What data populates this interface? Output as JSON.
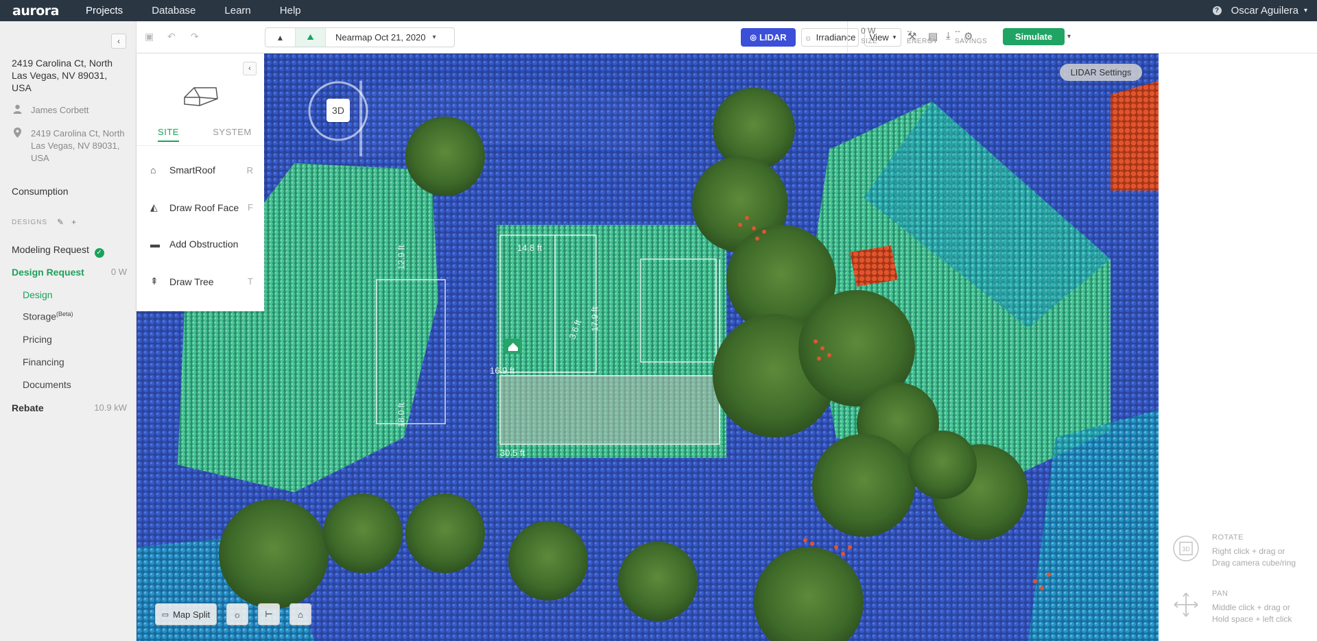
{
  "nav": {
    "logo": "aurora",
    "items": [
      "Projects",
      "Database",
      "Learn",
      "Help"
    ],
    "help_icon": "?",
    "user": "Oscar Aguilera",
    "user_chevron": "⌄"
  },
  "sidebar": {
    "project_title": "2419 Carolina Ct, North Las Vegas, NV 89031, USA",
    "customer": "James Corbett",
    "address": "2419 Carolina Ct, North Las Vegas, NV 89031, USA",
    "consumption": "Consumption",
    "designs_label": "DESIGNS",
    "modeling_request": "Modeling Request",
    "design_request": "Design Request",
    "design_request_value": "0 W",
    "sub_links": [
      "Design",
      "Storage",
      "Pricing",
      "Financing",
      "Documents"
    ],
    "storage_sup": "(Beta)",
    "rebate": "Rebate",
    "rebate_value": "10.9 kW"
  },
  "toolbar": {
    "imagery": "Nearmap Oct 21, 2020",
    "lidar": "LIDAR",
    "irradiance": "Irradiance",
    "view": "View",
    "size_value": "0 W",
    "size_label": "SIZE",
    "energy_value": "--",
    "energy_label": "ENERGY",
    "savings_value": "--",
    "savings_label": "SAVINGS",
    "simulate": "Simulate"
  },
  "toolpanel": {
    "tabs": [
      "SITE",
      "SYSTEM"
    ],
    "tools": [
      {
        "label": "SmartRoof",
        "key": "R",
        "icon": "smartroof-icon"
      },
      {
        "label": "Draw Roof Face",
        "key": "F",
        "icon": "roof-face-icon"
      },
      {
        "label": "Add Obstruction",
        "key": "",
        "icon": "obstruction-icon"
      },
      {
        "label": "Draw Tree",
        "key": "T",
        "icon": "tree-icon"
      }
    ]
  },
  "map": {
    "lidar_settings": "LIDAR Settings",
    "cube_label": "3D",
    "map_split": "Map Split",
    "measurements": [
      "14.8 ft",
      "17.9 ft",
      "12.9 ft",
      "18.0 ft",
      "3.6 ft",
      "16.9 ft",
      "30.5 ft"
    ]
  },
  "hints": [
    {
      "title": "ROTATE",
      "lines": [
        "Right click + drag or",
        "Drag camera cube/ring"
      ],
      "icon": "rotate-3d-icon"
    },
    {
      "title": "PAN",
      "lines": [
        "Middle click + drag or",
        "Hold space + left click"
      ],
      "icon": "pan-icon"
    }
  ],
  "colors": {
    "accent_green": "#1aa25a",
    "lidar_blue": "#3b4fd8",
    "nav_bg": "#2b3643",
    "lidar_points": [
      "#2f53c9",
      "#1fa9c9",
      "#3fc79d",
      "#e0552e"
    ]
  }
}
